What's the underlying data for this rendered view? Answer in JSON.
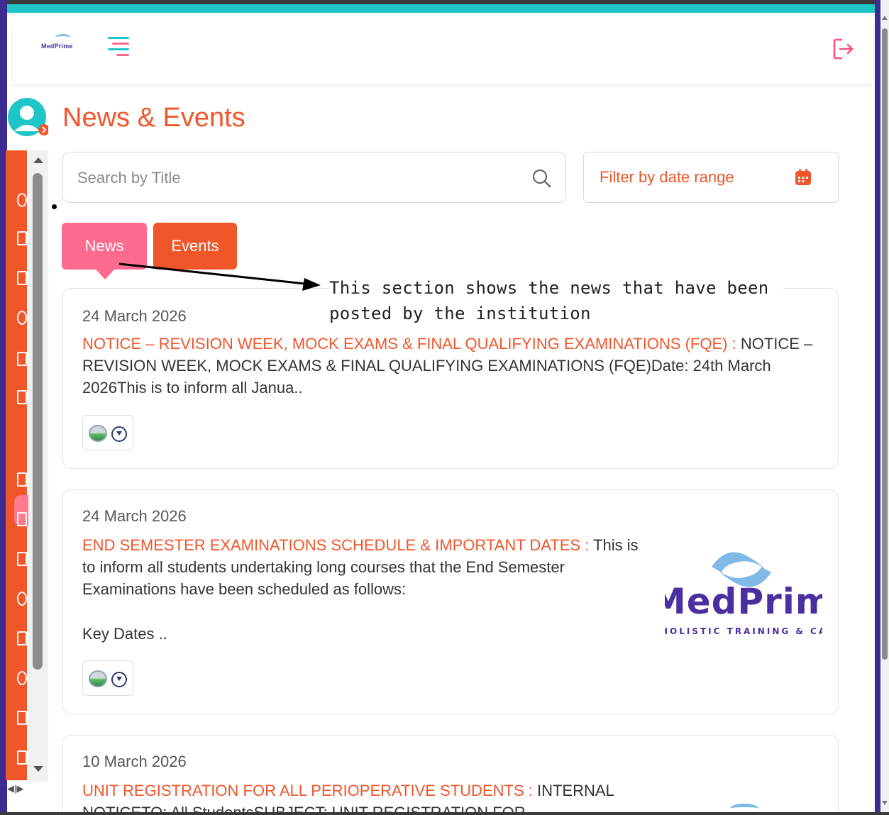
{
  "page": {
    "title": "News & Events"
  },
  "header": {
    "logo_text": "MedPrime"
  },
  "search": {
    "placeholder": "Search by Title"
  },
  "filter": {
    "label": "Filter by date range"
  },
  "tabs": [
    {
      "label": "News",
      "active": true
    },
    {
      "label": "Events",
      "active": false
    }
  ],
  "annotation": {
    "text": "This section shows the news that have been posted by the institution"
  },
  "news": [
    {
      "date": "24 March 2026",
      "title": "NOTICE – REVISION WEEK, MOCK EXAMS & FINAL QUALIFYING EXAMINATIONS (FQE) :",
      "summary": "NOTICE – REVISION WEEK, MOCK EXAMS & FINAL QUALIFYING EXAMINATIONS (FQE)Date: 24th March 2026This is to inform all Janua.."
    },
    {
      "date": "24 March 2026",
      "title": "END SEMESTER EXAMINATIONS SCHEDULE & IMPORTANT DATES :",
      "summary": "This is to inform all students undertaking long courses that the End Semester Examinations have been scheduled as follows:",
      "summary2": "Key Dates ..",
      "logo_main": "MedPrime",
      "logo_tagline": "HOLISTIC TRAINING & CARE"
    },
    {
      "date": "10 March 2026",
      "title": "UNIT REGISTRATION FOR ALL PERIOPERATIVE STUDENTS :",
      "summary": "INTERNAL NOTICETO: All StudentsSUBJECT: UNIT REGISTRATION FOR"
    }
  ],
  "colors": {
    "accent": "#f0562a",
    "news_tab": "#ff6b8f",
    "frame": "#3d2b8f",
    "teal": "#1fc6c8"
  }
}
